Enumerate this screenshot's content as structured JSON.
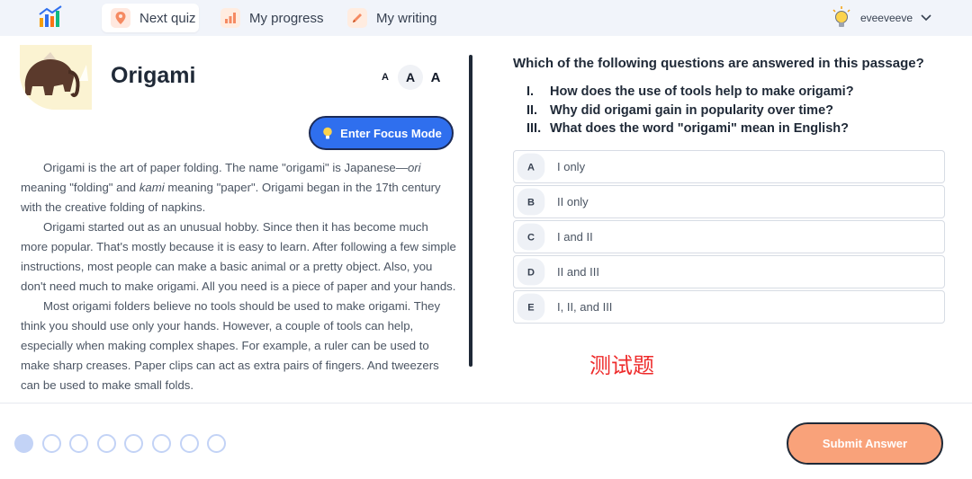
{
  "nav": {
    "items": [
      {
        "label": "Next quiz",
        "icon": "map-pin-icon"
      },
      {
        "label": "My progress",
        "icon": "bar-chart-icon"
      },
      {
        "label": "My writing",
        "icon": "pencil-icon"
      }
    ],
    "username": "eveeveeve"
  },
  "passage": {
    "title": "Origami",
    "font_sizes": [
      "A",
      "A",
      "A"
    ],
    "focus_label": "Enter Focus Mode",
    "p1": {
      "a": "Origami is the art of paper folding. The name \"origami\" is Japanese—",
      "ori": "ori",
      "b": " meaning \"folding\" and ",
      "kami": "kami",
      "c": " meaning \"paper\". Origami began in the 17th century with the creative folding of napkins."
    },
    "p2": "Origami started out as an unusual hobby. Since then it has become much more popular. That's mostly because it is easy to learn. After following a few simple instructions, most people can make a basic animal or a pretty object. Also, you don't need much to make origami. All you need is a piece of paper and your hands.",
    "p3": "Most origami folders believe no tools should be used to make origami. They think you should use only your hands. However, a couple of tools can help, especially when making complex shapes. For example, a ruler can be used to make sharp creases. Paper clips can act as extra pairs of fingers. And tweezers can be used to make small folds."
  },
  "question": {
    "text": "Which of the following questions are answered in this passage?",
    "items": [
      {
        "num": "I.",
        "text": "How does the use of tools help to make origami?"
      },
      {
        "num": "II.",
        "text": "Why did origami gain in popularity over time?"
      },
      {
        "num": "III.",
        "text": "What does the word \"origami\" mean in English?"
      }
    ],
    "options": [
      {
        "letter": "A",
        "text": "I only"
      },
      {
        "letter": "B",
        "text": "II only"
      },
      {
        "letter": "C",
        "text": "I and II"
      },
      {
        "letter": "D",
        "text": "II and III"
      },
      {
        "letter": "E",
        "text": "I, II, and III"
      }
    ]
  },
  "overlay_label": "测试题",
  "progress": {
    "total": 8,
    "current": 1
  },
  "submit_label": "Submit Answer",
  "colors": {
    "accent_blue": "#2f6fee",
    "submit_orange": "#f9a27a",
    "dot_blue": "#c3d3f6",
    "overlay_red": "#ee2b2b"
  }
}
